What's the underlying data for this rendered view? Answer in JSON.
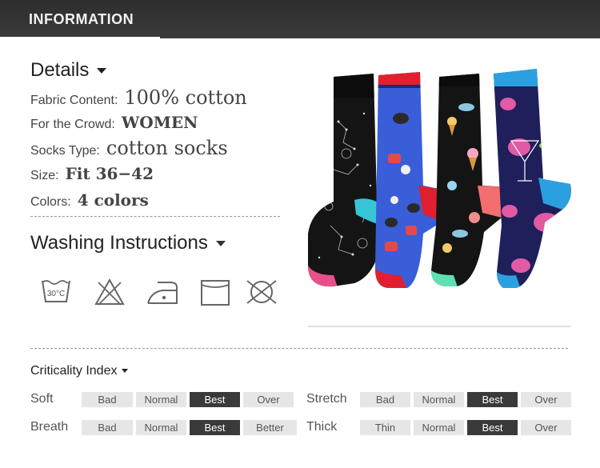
{
  "header": {
    "title": "INFORMATION"
  },
  "details": {
    "heading": "Details",
    "specs": [
      {
        "label": "Fabric Content",
        "value": "100% cotton"
      },
      {
        "label": "For the Crowd",
        "value": "WOMEN"
      },
      {
        "label": "Socks Type",
        "value": "cotton socks"
      },
      {
        "label": "Size",
        "value": "Fit 36−42"
      },
      {
        "label": "Colors",
        "value": "4 colors"
      }
    ]
  },
  "washing": {
    "heading": "Washing Instructions",
    "icons": [
      {
        "name": "wash-30c-icon",
        "text": "30°C"
      },
      {
        "name": "no-bleach-icon"
      },
      {
        "name": "iron-low-icon"
      },
      {
        "name": "tumble-dry-icon"
      },
      {
        "name": "do-not-dry-clean-icon"
      }
    ]
  },
  "criticality": {
    "title": "Criticality Index",
    "rows": [
      {
        "label": "Soft",
        "options": [
          "Bad",
          "Normal",
          "Best",
          "Over"
        ],
        "selected": "Best"
      },
      {
        "label": "Stretch",
        "options": [
          "Bad",
          "Normal",
          "Best",
          "Over"
        ],
        "selected": "Best"
      },
      {
        "label": "Breath",
        "options": [
          "Bad",
          "Normal",
          "Best",
          "Better"
        ],
        "selected": "Best"
      },
      {
        "label": "Thick",
        "options": [
          "Thin",
          "Normal",
          "Best",
          "Over"
        ],
        "selected": "Best"
      }
    ]
  },
  "colors": {
    "header_bg": "#333333",
    "active_box": "#3a3a3a",
    "inactive_box": "#e6e6e6"
  }
}
